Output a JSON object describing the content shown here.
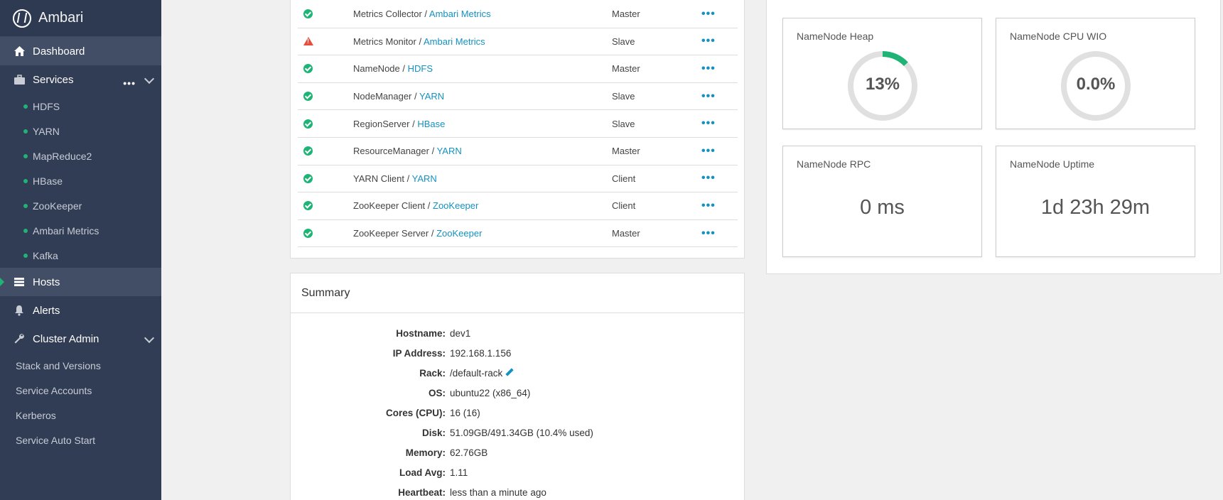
{
  "sidebar": {
    "brand": "Ambari",
    "dashboard": "Dashboard",
    "services": "Services",
    "service_items": [
      "HDFS",
      "YARN",
      "MapReduce2",
      "HBase",
      "ZooKeeper",
      "Ambari Metrics",
      "Kafka"
    ],
    "hosts": "Hosts",
    "alerts": "Alerts",
    "cluster_admin": "Cluster Admin",
    "admin_items": [
      "Stack and Versions",
      "Service Accounts",
      "Kerberos",
      "Service Auto Start"
    ]
  },
  "components": [
    {
      "status": "ok",
      "name": "Metrics Collector",
      "service": "Ambari Metrics",
      "role": "Master"
    },
    {
      "status": "warn",
      "name": "Metrics Monitor",
      "service": "Ambari Metrics",
      "role": "Slave"
    },
    {
      "status": "ok",
      "name": "NameNode",
      "service": "HDFS",
      "role": "Master"
    },
    {
      "status": "ok",
      "name": "NodeManager",
      "service": "YARN",
      "role": "Slave"
    },
    {
      "status": "ok",
      "name": "RegionServer",
      "service": "HBase",
      "role": "Slave"
    },
    {
      "status": "ok",
      "name": "ResourceManager",
      "service": "YARN",
      "role": "Master"
    },
    {
      "status": "ok",
      "name": "YARN Client",
      "service": "YARN",
      "role": "Client"
    },
    {
      "status": "ok",
      "name": "ZooKeeper Client",
      "service": "ZooKeeper",
      "role": "Client"
    },
    {
      "status": "ok",
      "name": "ZooKeeper Server",
      "service": "ZooKeeper",
      "role": "Master"
    }
  ],
  "summary": {
    "title": "Summary",
    "rows": [
      {
        "key": "Hostname:",
        "value": "dev1"
      },
      {
        "key": "IP Address:",
        "value": "192.168.1.156"
      },
      {
        "key": "Rack:",
        "value": "/default-rack"
      },
      {
        "key": "OS:",
        "value": "ubuntu22 (x86_64)"
      },
      {
        "key": "Cores (CPU):",
        "value": "16 (16)"
      },
      {
        "key": "Disk:",
        "value": "51.09GB/491.34GB (10.4% used)"
      },
      {
        "key": "Memory:",
        "value": "62.76GB"
      },
      {
        "key": "Load Avg:",
        "value": "1.11"
      },
      {
        "key": "Heartbeat:",
        "value": "less than a minute ago"
      }
    ]
  },
  "widgets": {
    "heap": {
      "title": "NameNode Heap",
      "value": "13%",
      "fraction": 0.13
    },
    "cpu": {
      "title": "NameNode CPU WIO",
      "value": "0.0%",
      "fraction": 0.0
    },
    "rpc": {
      "title": "NameNode RPC",
      "value": "0 ms"
    },
    "uptime": {
      "title": "NameNode Uptime",
      "value": "1d 23h 29m"
    }
  },
  "colors": {
    "sidebar_bg": "#313d54",
    "accent_green": "#1eb475",
    "link_blue": "#1491c1",
    "warn_red": "#e74c3c",
    "gauge_track": "#e0e0e0"
  }
}
